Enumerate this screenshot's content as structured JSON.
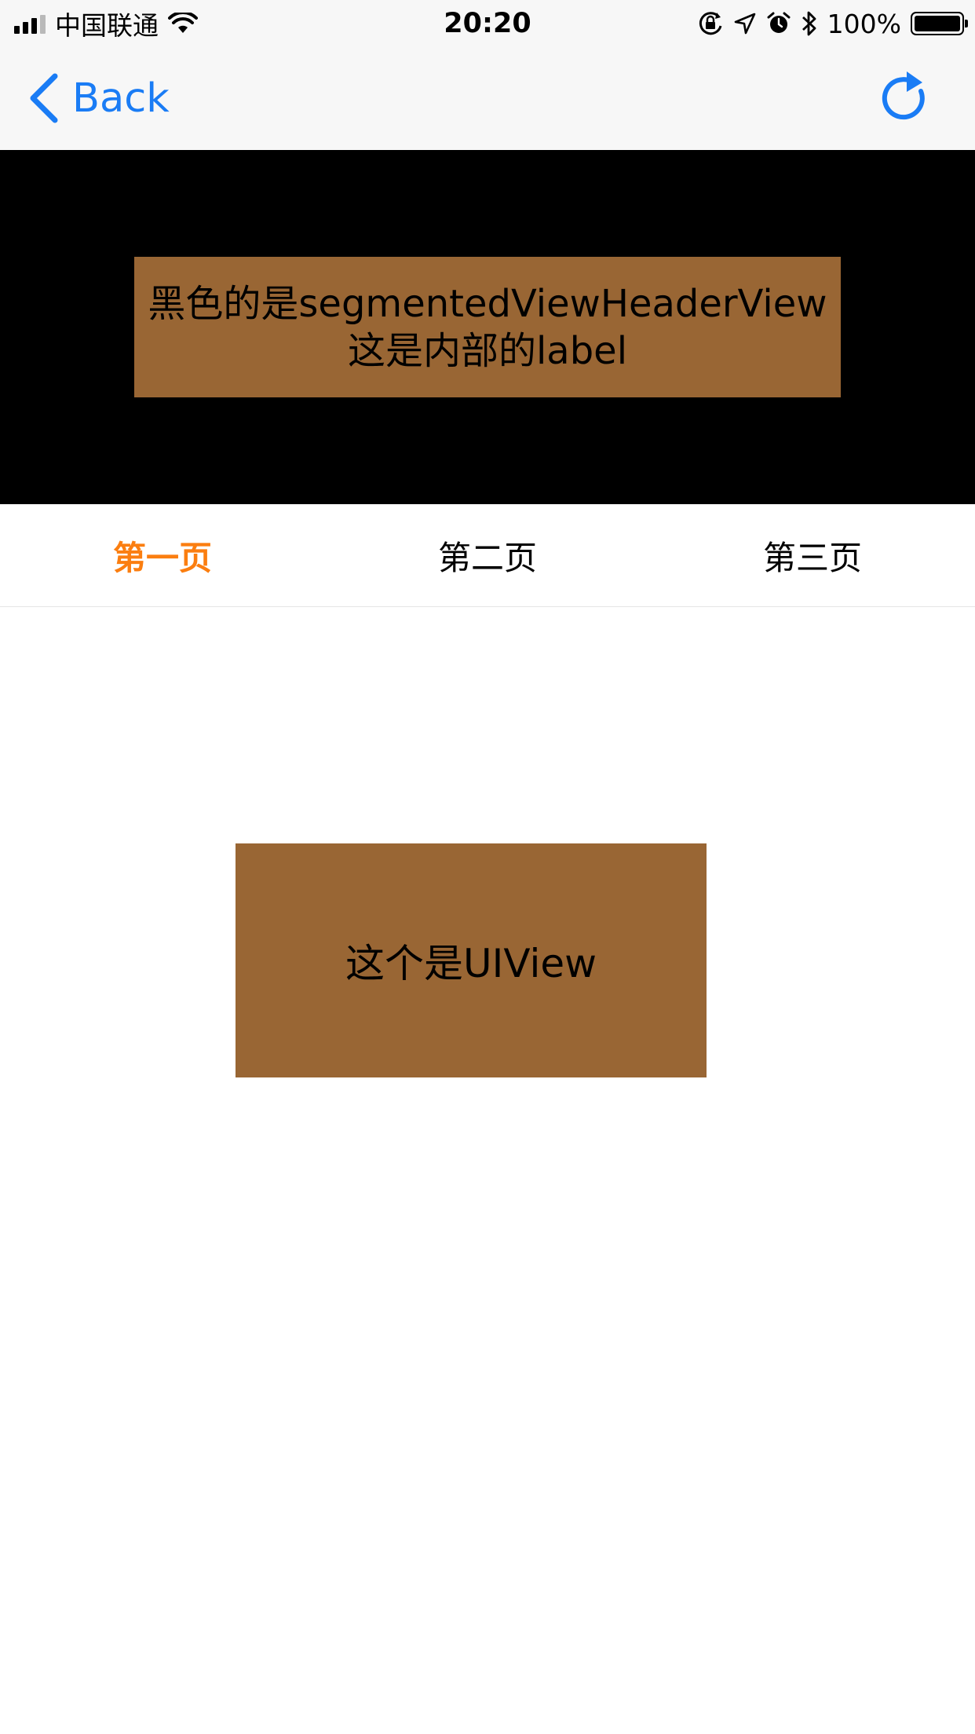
{
  "status_bar": {
    "carrier": "中国联通",
    "time": "20:20",
    "battery_percent": "100%",
    "signal_bars_active": 3,
    "signal_bars_total": 5,
    "icons": [
      "wifi-icon",
      "orientation-lock-icon",
      "location-arrow-icon",
      "alarm-icon",
      "bluetooth-icon",
      "battery-icon"
    ]
  },
  "nav": {
    "back_label": "Back",
    "refresh_icon": "refresh-icon",
    "accent_color": "#1a7cf5"
  },
  "header_view": {
    "background_color": "#000000",
    "label_line1": "黑色的是segmentedViewHeaderView",
    "label_line2": "这是内部的label",
    "label_background": "#996634"
  },
  "tabs": {
    "items": [
      {
        "label": "第一页",
        "selected": true
      },
      {
        "label": "第二页",
        "selected": false
      },
      {
        "label": "第三页",
        "selected": false
      }
    ],
    "selected_color": "#fb7e10"
  },
  "content": {
    "box_label": "这个是UIView",
    "box_background": "#996634"
  }
}
